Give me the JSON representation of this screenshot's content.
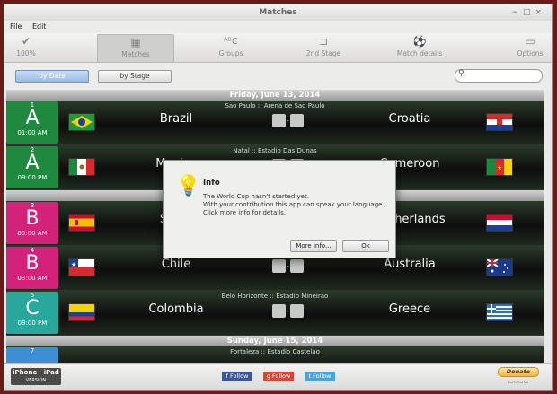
{
  "window": {
    "title": "Matches"
  },
  "menu": [
    "File",
    "Edit"
  ],
  "toolbar": {
    "progress": "100%",
    "items": [
      {
        "label": "Matches",
        "icon": "calendar-icon"
      },
      {
        "label": "Groups",
        "icon": "abc-icon"
      },
      {
        "label": "2nd Stage",
        "icon": "bracket-icon"
      },
      {
        "label": "Match details",
        "icon": "ball-icon"
      },
      {
        "label": "Options",
        "icon": "options-icon"
      }
    ]
  },
  "filters": {
    "by_date": "by Date",
    "by_stage": "by Stage",
    "search_placeholder": ""
  },
  "days": {
    "friday": "Friday, June 13, 2014",
    "sunday": "Sunday, June 15, 2014"
  },
  "matches": [
    {
      "num": "1",
      "group": "A",
      "time": "01:00 AM",
      "color": "#1f8a3f",
      "venue": "Sao Paulo :: Arena de Sao Paulo",
      "home": "Brazil",
      "away": "Croatia"
    },
    {
      "num": "2",
      "group": "A",
      "time": "09:00 PM",
      "color": "#1f8a3f",
      "venue": "Natal :: Estadio Das Dunas",
      "home": "Mexico",
      "away": "Cameroon"
    },
    {
      "num": "3",
      "group": "B",
      "time": "00:00 AM",
      "color": "#d2227a",
      "venue": "",
      "home": "Spain",
      "away": "Netherlands"
    },
    {
      "num": "4",
      "group": "B",
      "time": "03:00 AM",
      "color": "#d2227a",
      "venue": "",
      "home": "Chile",
      "away": "Australia"
    },
    {
      "num": "5",
      "group": "C",
      "time": "09:00 PM",
      "color": "#28a79c",
      "venue": "Belo Horizonte :: Estadio Mineirao",
      "home": "Colombia",
      "away": "Greece"
    },
    {
      "num": "7",
      "group": "",
      "time": "",
      "color": "#3a8fd6",
      "venue": "Fortaleza :: Estadio Castelao",
      "home": "",
      "away": ""
    }
  ],
  "score_sep": "-",
  "footer": {
    "iphone": "iPhone · iPad",
    "version": "VERSION",
    "follow": "Follow",
    "donate": "Donate"
  },
  "dialog": {
    "title": "Info",
    "line1": "The World Cup hasn't started yet.",
    "line2": "With your contribution this app can speak your language.",
    "line3": "Click more info for details.",
    "more": "More info...",
    "ok": "Ok"
  }
}
